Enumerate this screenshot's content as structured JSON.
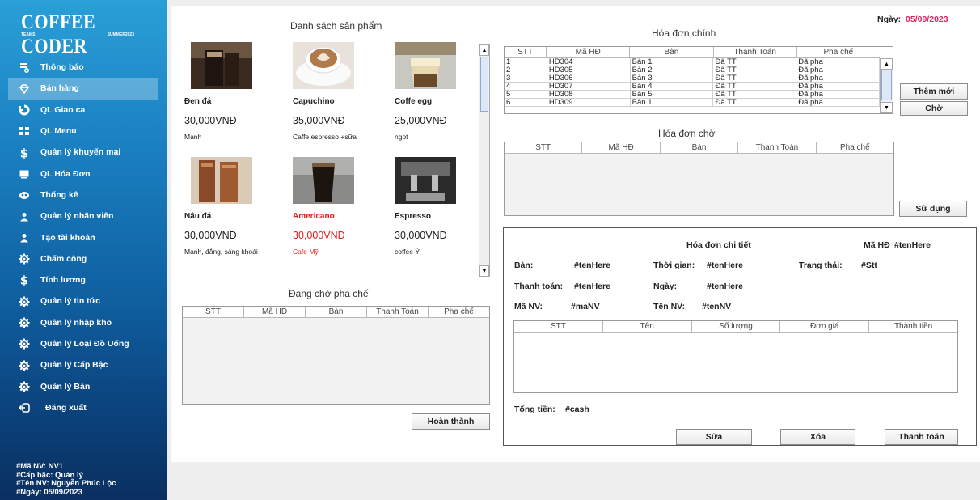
{
  "sidebar": {
    "logo_title": "COFFEE CODER",
    "logo_left": "TEAMS",
    "logo_right": "SUMMER2023",
    "items": [
      {
        "label": "Thông báo",
        "icon": "notification-icon",
        "active": false
      },
      {
        "label": "Bán hàng",
        "icon": "sales-icon",
        "active": true
      },
      {
        "label": "QL Giao ca",
        "icon": "shift-icon",
        "active": false
      },
      {
        "label": "QL Menu",
        "icon": "menu-grid-icon",
        "active": false
      },
      {
        "label": "Quản lý khuyến mại",
        "icon": "dollar-icon",
        "active": false
      },
      {
        "label": "QL Hóa Đơn",
        "icon": "invoice-icon",
        "active": false
      },
      {
        "label": "Thống kê",
        "icon": "statistics-icon",
        "active": false
      },
      {
        "label": "Quản lý nhân viên",
        "icon": "user-icon",
        "active": false
      },
      {
        "label": "Tạo tài khoản",
        "icon": "user-add-icon",
        "active": false
      },
      {
        "label": "Chấm công",
        "icon": "gear-icon",
        "active": false
      },
      {
        "label": "Tính lương",
        "icon": "dollar-icon",
        "active": false
      },
      {
        "label": "Quản lý tin tức",
        "icon": "gear-icon",
        "active": false
      },
      {
        "label": "Quản lý nhập kho",
        "icon": "gear-icon",
        "active": false
      },
      {
        "label": "Quản lý Loại Đồ Uống",
        "icon": "gear-icon",
        "active": false
      },
      {
        "label": "Quản lý Cấp Bậc",
        "icon": "gear-icon",
        "active": false
      },
      {
        "label": "Quản lý Bàn",
        "icon": "gear-icon",
        "active": false
      },
      {
        "label": "Đăng xuất",
        "icon": "logout-icon",
        "active": false
      }
    ],
    "user": {
      "ma_nv": "#Mã NV:  NV1",
      "cap_bac": "#Cấp bậc:  Quản lý",
      "ten_nv": "#Tên NV:  Nguyễn Phúc Lộc",
      "ngay": "#Ngày:  05/09/2023"
    }
  },
  "header": {
    "date_label": "Ngày:",
    "date_value": "05/09/2023"
  },
  "products": {
    "title": "Danh sách sản phẩm",
    "items": [
      {
        "name": "Đen đá",
        "price": "30,000VNĐ",
        "desc": "Manh",
        "selected": false,
        "image": "iced-black-coffee-image"
      },
      {
        "name": "Capuchino",
        "price": "35,000VNĐ",
        "desc": "Caffe espresso +sữa",
        "selected": false,
        "image": "cappuccino-image"
      },
      {
        "name": "Coffe egg",
        "price": "25,000VNĐ",
        "desc": "ngot",
        "selected": false,
        "image": "egg-coffee-image"
      },
      {
        "name": "Nâu đá",
        "price": "30,000VNĐ",
        "desc": "Manh, đắng, sảng khoái",
        "selected": false,
        "image": "iced-milk-coffee-image"
      },
      {
        "name": "Americano",
        "price": "30,000VNĐ",
        "desc": "Cafe Mỹ",
        "selected": true,
        "image": "americano-image"
      },
      {
        "name": "Espresso",
        "price": "30,000VNĐ",
        "desc": "coffee Ý",
        "selected": false,
        "image": "espresso-image"
      }
    ]
  },
  "waiting_prep": {
    "title": "Đang chờ pha chế",
    "columns": [
      "STT",
      "Mã HĐ",
      "Bàn",
      "Thanh Toán",
      "Pha chế"
    ],
    "done_button": "Hoàn thành"
  },
  "main_invoice": {
    "title": "Hóa đơn chính",
    "columns": [
      "STT",
      "Mã HĐ",
      "Bàn",
      "Thanh Toán",
      "Pha chế"
    ],
    "rows": [
      [
        "1",
        "HD304",
        "Bàn 1",
        "Đã TT",
        "Đã pha"
      ],
      [
        "2",
        "HD305",
        "Bàn 2",
        "Đã TT",
        "Đã pha"
      ],
      [
        "3",
        "HD306",
        "Bàn 3",
        "Đã TT",
        "Đã pha"
      ],
      [
        "4",
        "HD307",
        "Bàn 4",
        "Đã TT",
        "Đã pha"
      ],
      [
        "5",
        "HD308",
        "Bàn 5",
        "Đã TT",
        "Đã pha"
      ],
      [
        "6",
        "HD309",
        "Bàn 1",
        "Đã TT",
        "Đã pha"
      ]
    ],
    "new_button": "Thêm mới",
    "wait_button": "Chờ"
  },
  "waiting_invoice": {
    "title": "Hóa đơn chờ",
    "columns": [
      "STT",
      "Mã HĐ",
      "Bàn",
      "Thanh Toán",
      "Pha chế"
    ],
    "use_button": "Sử dụng"
  },
  "detail": {
    "title": "Hóa đơn chi tiết",
    "ma_hd_label": "Mã HĐ",
    "ma_hd_value": "#tenHere",
    "ban_label": "Bàn:",
    "ban_value": "#tenHere",
    "thoigian_label": "Thời gian:",
    "thoigian_value": "#tenHere",
    "trangthai_label": "Trạng thái:",
    "trangthai_value": "#Stt",
    "thanhtoan_label": "Thanh toán:",
    "thanhtoan_value": "#tenHere",
    "ngay_label": "Ngày:",
    "ngay_value": "#tenHere",
    "manv_label": "Mã NV:",
    "manv_value": "#maNV",
    "tennv_label": "Tên NV:",
    "tennv_value": "#tenNV",
    "columns": [
      "STT",
      "Tên",
      "Số lượng",
      "Đơn giá",
      "Thành tiền"
    ],
    "total_label": "Tổng tiền:",
    "total_value": "#cash",
    "edit_button": "Sửa",
    "delete_button": "Xóa",
    "pay_button": "Thanh toán"
  }
}
